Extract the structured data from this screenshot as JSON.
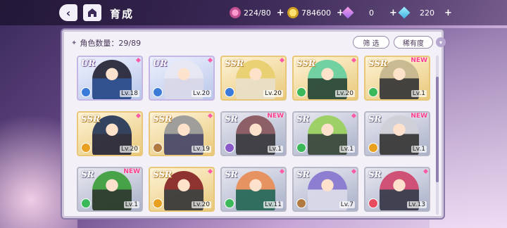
{
  "header": {
    "title": "育成",
    "resources": [
      {
        "name": "candy",
        "value": "224/80",
        "icon": "candy-icon"
      },
      {
        "name": "coin",
        "value": "784600",
        "icon": "coin-icon"
      },
      {
        "name": "gem",
        "value": "0",
        "icon": "gem-icon"
      },
      {
        "name": "diamond",
        "value": "220",
        "icon": "diamond-icon"
      }
    ],
    "plus": "+"
  },
  "panel": {
    "count_label": "角色数量：29/89",
    "filter_label": "筛 选",
    "rarity_label": "稀有度"
  },
  "cards": [
    {
      "rarity": "UR",
      "level": "Lv.18",
      "new": "",
      "elem_color": "#3a7ad8",
      "hair": "#2a2a3a",
      "cloth": "#2a4a8a"
    },
    {
      "rarity": "UR",
      "level": "Lv.20",
      "new": "",
      "elem_color": "#3a7ad8",
      "hair": "#e8e8f4",
      "cloth": "#d8d8e8"
    },
    {
      "rarity": "SSR",
      "level": "Lv.20",
      "new": "",
      "elem_color": "#3a7ad8",
      "hair": "#e8d070",
      "cloth": "#e8e0c8"
    },
    {
      "rarity": "SSR",
      "level": "Lv.20",
      "new": "",
      "elem_color": "#3ab85a",
      "hair": "#6ad0a0",
      "cloth": "#2a4a3a"
    },
    {
      "rarity": "SSR",
      "level": "Lv.1",
      "new": "NEW",
      "elem_color": "#3ab85a",
      "hair": "#c8b890",
      "cloth": "#3a3a3a"
    },
    {
      "rarity": "SSR",
      "level": "Lv.20",
      "new": "",
      "elem_color": "#e8a020",
      "hair": "#2a3a5a",
      "cloth": "#2a2a3a"
    },
    {
      "rarity": "SSR",
      "level": "Lv.19",
      "new": "",
      "elem_color": "#b07a40",
      "hair": "#9a9a9a",
      "cloth": "#4a4a6a"
    },
    {
      "rarity": "SR",
      "level": "Lv.1",
      "new": "NEW",
      "elem_color": "#8a5ac8",
      "hair": "#8a5a60",
      "cloth": "#3a3a40"
    },
    {
      "rarity": "SR",
      "level": "Lv.1",
      "new": "",
      "elem_color": "#3ab85a",
      "hair": "#9ad060",
      "cloth": "#3a4a3a"
    },
    {
      "rarity": "SR",
      "level": "Lv.1",
      "new": "NEW",
      "elem_color": "#e8a020",
      "hair": "#d0d0d8",
      "cloth": "#3a3a3a"
    },
    {
      "rarity": "SR",
      "level": "Lv.1",
      "new": "NEW",
      "elem_color": "#3ab85a",
      "hair": "#40a040",
      "cloth": "#2a3a2a"
    },
    {
      "rarity": "SSR",
      "level": "Lv.20",
      "new": "",
      "elem_color": "#e8a020",
      "hair": "#8a2a2a",
      "cloth": "#3a3a3a"
    },
    {
      "rarity": "SR",
      "level": "Lv.11",
      "new": "",
      "elem_color": "#3ab85a",
      "hair": "#e8905a",
      "cloth": "#2a6a5a"
    },
    {
      "rarity": "SR",
      "level": "Lv.7",
      "new": "",
      "elem_color": "#b07a40",
      "hair": "#8a7ad0",
      "cloth": "#d8d8e8"
    },
    {
      "rarity": "SR",
      "level": "Lv.13",
      "new": "",
      "elem_color": "#e84a60",
      "hair": "#d04a70",
      "cloth": "#3a3a4a"
    }
  ]
}
